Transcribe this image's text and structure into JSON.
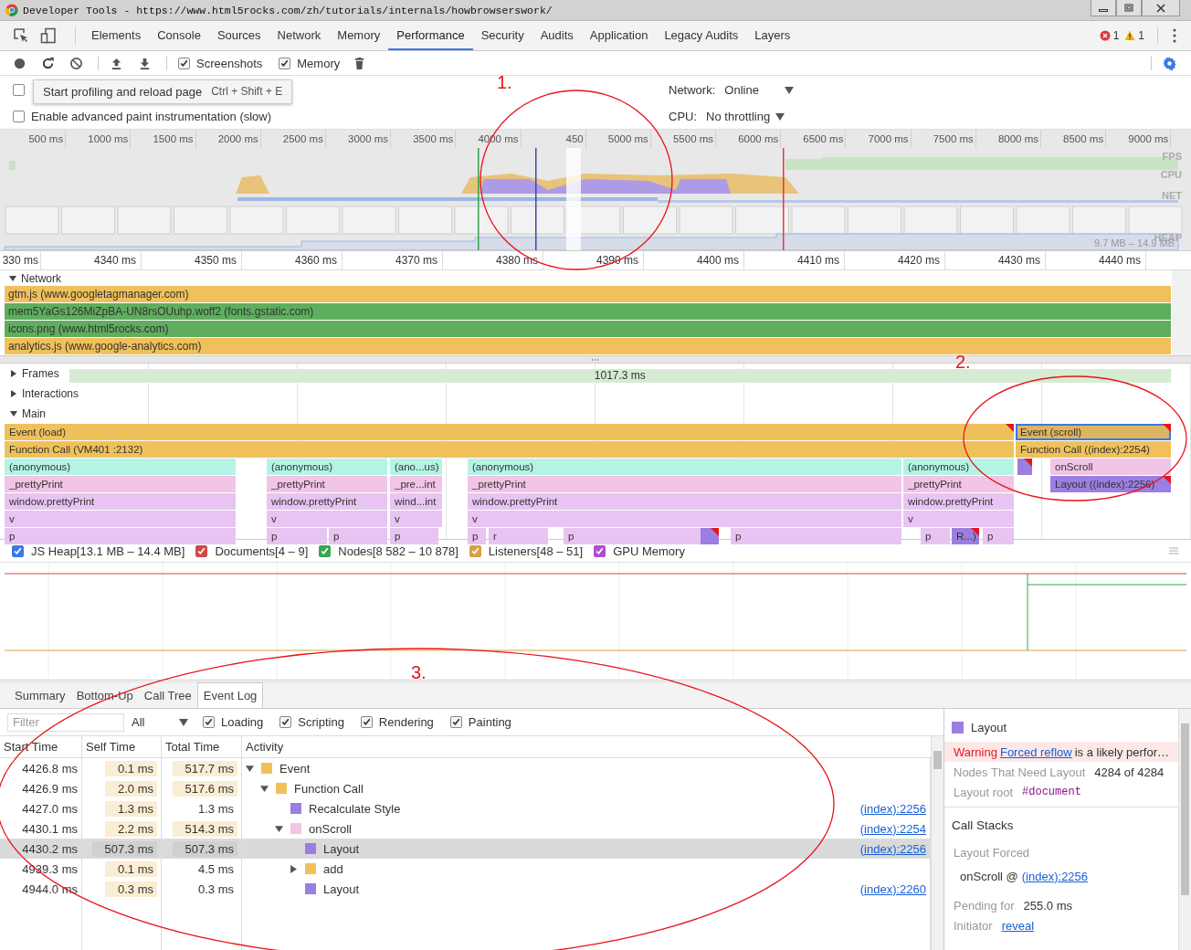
{
  "window": {
    "title": "Developer Tools - https://www.html5rocks.com/zh/tutorials/internals/howbrowserswork/"
  },
  "tabs": [
    {
      "label": "Elements",
      "selected": false
    },
    {
      "label": "Console",
      "selected": false
    },
    {
      "label": "Sources",
      "selected": false
    },
    {
      "label": "Network",
      "selected": false
    },
    {
      "label": "Memory",
      "selected": false
    },
    {
      "label": "Performance",
      "selected": true
    },
    {
      "label": "Security",
      "selected": false
    },
    {
      "label": "Audits",
      "selected": false
    },
    {
      "label": "Application",
      "selected": false
    },
    {
      "label": "Legacy Audits",
      "selected": false
    },
    {
      "label": "Layers",
      "selected": false
    }
  ],
  "issues": {
    "errors": "1",
    "warnings": "1"
  },
  "toolbar": {
    "checkboxes": [
      {
        "label": "Screenshots",
        "checked": true
      },
      {
        "label": "Memory",
        "checked": true
      }
    ]
  },
  "settings": {
    "options": [
      {
        "checked": false
      },
      {
        "label": "Enable advanced paint instrumentation (slow)",
        "checked": false
      }
    ],
    "tooltip": {
      "text": "Start profiling and reload page",
      "shortcut": "Ctrl + Shift + E"
    },
    "network": {
      "label": "Network:",
      "value": "Online"
    },
    "cpu": {
      "label": "CPU:",
      "value": "No throttling"
    }
  },
  "overview": {
    "ticks": [
      "500 ms",
      "1000 ms",
      "1500 ms",
      "2000 ms",
      "2500 ms",
      "3000 ms",
      "3500 ms",
      "4000 ms",
      "450",
      "5000 ms",
      "5500 ms",
      "6000 ms",
      "6500 ms",
      "7000 ms",
      "7500 ms",
      "8000 ms",
      "8500 ms",
      "9000 ms"
    ],
    "lanes": [
      "FPS",
      "CPU",
      "NET",
      "HEAP"
    ],
    "heap_range": "9.7 MB – 14.9 MB"
  },
  "ruler": [
    "330 ms",
    "4340 ms",
    "4350 ms",
    "4360 ms",
    "4370 ms",
    "4380 ms",
    "4390 ms",
    "4400 ms",
    "4410 ms",
    "4420 ms",
    "4430 ms",
    "4440 ms"
  ],
  "network": {
    "label": "Network",
    "expanded": true,
    "requests": [
      {
        "name": "gtm.js (www.googletagmanager.com)",
        "color": "#f0c15b"
      },
      {
        "name": "mem5YaGs126MiZpBA-UN8rsOUuhp.woff2 (fonts.gstatic.com)",
        "color": "#5fae5f"
      },
      {
        "name": "icons.png (www.html5rocks.com)",
        "color": "#5fae5f"
      },
      {
        "name": "analytics.js (www.google-analytics.com)",
        "color": "#f0c15b"
      }
    ]
  },
  "tracks": [
    {
      "label": "Frames",
      "expanded": false,
      "value": "1017.3 ms"
    },
    {
      "label": "Interactions",
      "expanded": false
    },
    {
      "label": "Main",
      "expanded": true
    }
  ],
  "flame": [
    [
      {
        "label": "Event (load)",
        "color": "#f0c15b",
        "warning": true,
        "selected": false
      },
      {
        "label": "Event (scroll)",
        "color": "#ddb55e",
        "warning": true,
        "selected": true
      }
    ],
    [
      {
        "label": "Function Call (VM401 :2132)",
        "color": "#f0c15b",
        "warning": false,
        "selected": false
      },
      {
        "label": "Function Call ((index):2254)",
        "color": "#f0c15b",
        "warning": false,
        "selected": false
      }
    ],
    [
      {
        "label": "(anonymous)",
        "color": "#b4f4e4",
        "warning": false,
        "selected": false
      },
      {
        "label": "(anonymous)",
        "color": "#b4f4e4",
        "warning": false,
        "selected": false
      },
      {
        "label": "(ano...us)",
        "color": "#b4f4e4",
        "warning": false,
        "selected": false
      },
      {
        "label": "(anonymous)",
        "color": "#b4f4e4",
        "warning": false,
        "selected": false
      },
      {
        "label": "(anonymous)",
        "color": "#b4f4e4",
        "warning": false,
        "selected": false
      },
      {
        "color": "#9b7fe0",
        "warning": true,
        "selected": false
      },
      {
        "label": "onScroll",
        "color": "#f2c4e6",
        "warning": false,
        "selected": false
      }
    ],
    [
      {
        "label": "_prettyPrint",
        "color": "#f2c4e6",
        "warning": false,
        "selected": false
      },
      {
        "label": "_prettyPrint",
        "color": "#f2c4e6",
        "warning": false,
        "selected": false
      },
      {
        "label": "_pre...int",
        "color": "#f2c4e6",
        "warning": false,
        "selected": false
      },
      {
        "label": "_prettyPrint",
        "color": "#f2c4e6",
        "warning": false,
        "selected": false
      },
      {
        "label": "_prettyPrint",
        "color": "#f2c4e6",
        "warning": false,
        "selected": false
      },
      {
        "label": "Layout ((index):2256)",
        "color": "#9b7fe0",
        "warning": true,
        "selected": false
      }
    ],
    [
      {
        "label": "window.prettyPrint",
        "color": "#e8c4f2",
        "warning": false,
        "selected": false
      },
      {
        "label": "window.prettyPrint",
        "color": "#e8c4f2",
        "warning": false,
        "selected": false
      },
      {
        "label": "wind...int",
        "color": "#e8c4f2",
        "warning": false,
        "selected": false
      },
      {
        "label": "window.prettyPrint",
        "color": "#e8c4f2",
        "warning": false,
        "selected": false
      },
      {
        "label": "window.prettyPrint",
        "color": "#e8c4f2",
        "warning": false,
        "selected": false
      }
    ],
    [
      {
        "label": "v",
        "color": "#e8c4f2",
        "warning": false,
        "selected": false
      },
      {
        "label": "v",
        "color": "#e8c4f2",
        "warning": false,
        "selected": false
      },
      {
        "label": "v",
        "color": "#e8c4f2",
        "warning": false,
        "selected": false
      },
      {
        "label": "v",
        "color": "#e8c4f2",
        "warning": false,
        "selected": false
      },
      {
        "label": "v",
        "color": "#e8c4f2",
        "warning": false,
        "selected": false
      }
    ],
    [
      {
        "label": "p",
        "color": "#e8c4f2",
        "warning": false,
        "selected": false
      },
      {
        "label": "p",
        "color": "#e8c4f2",
        "warning": false,
        "selected": false
      },
      {
        "label": "p",
        "color": "#e8c4f2",
        "warning": false,
        "selected": false
      },
      {
        "label": "p",
        "color": "#e8c4f2",
        "warning": false,
        "selected": false
      },
      {
        "label": "p",
        "color": "#e8c4f2",
        "warning": false,
        "selected": false
      },
      {
        "label": "r",
        "color": "#e8c4f2",
        "warning": false,
        "selected": false
      },
      {
        "label": "p",
        "color": "#e8c4f2",
        "warning": false,
        "selected": false
      },
      {
        "color": "#9b7fe0",
        "warning": true,
        "selected": false
      },
      {
        "label": "p",
        "color": "#e8c4f2",
        "warning": false,
        "selected": false
      },
      {
        "label": "p",
        "color": "#e8c4f2",
        "warning": false,
        "selected": false
      },
      {
        "label": "R...)",
        "color": "#9b7fe0",
        "warning": true,
        "selected": false
      },
      {
        "label": "p",
        "color": "#e8c4f2",
        "warning": false,
        "selected": false
      }
    ]
  ],
  "counters": [
    {
      "label": "JS Heap[13.1 MB – 14.4 MB]",
      "checked": true,
      "color": "#3b78e7"
    },
    {
      "label": "Documents[4 – 9]",
      "checked": true,
      "color": "#d04848"
    },
    {
      "label": "Nodes[8 582 – 10 878]",
      "checked": true,
      "color": "#34a853"
    },
    {
      "label": "Listeners[48 – 51]",
      "checked": true,
      "color": "#d8a040"
    },
    {
      "label": "GPU Memory",
      "checked": true,
      "color": "#b04fd1"
    }
  ],
  "detail_tabs": [
    {
      "label": "Summary",
      "selected": false
    },
    {
      "label": "Bottom-Up",
      "selected": false
    },
    {
      "label": "Call Tree",
      "selected": false
    },
    {
      "label": "Event Log",
      "selected": true
    }
  ],
  "filter": {
    "placeholder": "Filter",
    "scope": "All",
    "categories": [
      {
        "label": "Loading",
        "checked": true
      },
      {
        "label": "Scripting",
        "checked": true
      },
      {
        "label": "Rendering",
        "checked": true
      },
      {
        "label": "Painting",
        "checked": true
      }
    ]
  },
  "table": {
    "columns": [
      "Start Time",
      "Self Time",
      "Total Time",
      "Activity"
    ],
    "rows": [
      {
        "start": "4426.8 ms",
        "self": "0.1 ms",
        "total": "517.7 ms",
        "total_shaded": true,
        "activity": "Event",
        "color": "#f0c15b",
        "selected": false,
        "expanded": true,
        "children": [
          {
            "start": "4426.9 ms",
            "self": "2.0 ms",
            "total": "517.6 ms",
            "total_shaded": true,
            "activity": "Function Call",
            "color": "#f0c15b",
            "selected": false,
            "expanded": true,
            "children": [
              {
                "start": "4427.0 ms",
                "self": "1.3 ms",
                "total": "1.3 ms",
                "total_shaded": false,
                "activity": "Recalculate Style",
                "color": "#9b7fe0",
                "selected": false,
                "link": "(index):2256"
              },
              {
                "start": "4430.1 ms",
                "self": "2.2 ms",
                "total": "514.3 ms",
                "total_shaded": true,
                "activity": "onScroll",
                "color": "#f2c4e6",
                "selected": false,
                "expanded": true,
                "link": "(index):2254",
                "children": [
                  {
                    "start": "4430.2 ms",
                    "self": "507.3 ms",
                    "total": "507.3 ms",
                    "total_shaded": true,
                    "activity": "Layout",
                    "color": "#9b7fe0",
                    "selected": true,
                    "link": "(index):2256"
                  },
                  {
                    "start": "4939.3 ms",
                    "self": "0.1 ms",
                    "total": "4.5 ms",
                    "total_shaded": false,
                    "activity": "add",
                    "color": "#f0c15b",
                    "selected": false,
                    "expanded": false
                  },
                  {
                    "start": "4944.0 ms",
                    "self": "0.3 ms",
                    "total": "0.3 ms",
                    "total_shaded": false,
                    "activity": "Layout",
                    "color": "#9b7fe0",
                    "selected": false,
                    "link": "(index):2260"
                  }
                ]
              }
            ]
          }
        ]
      }
    ]
  },
  "details": {
    "title": "Layout",
    "color": "#9b7fe0",
    "warning": {
      "label": "Warning",
      "link": "Forced reflow",
      "text": "is a likely perfor…"
    },
    "fields": [
      {
        "label": "Nodes That Need Layout",
        "value": "4284 of 4284",
        "kind": "plain"
      },
      {
        "label": "Layout root",
        "value": "#document",
        "kind": "code"
      }
    ],
    "call_stacks": {
      "title": "Call Stacks",
      "label": "Layout Forced",
      "frame": "onScroll @",
      "link": "(index):2256"
    },
    "extra": [
      {
        "label": "Pending for",
        "value": "255.0 ms",
        "kind": "plain"
      },
      {
        "label": "Initiator",
        "value": "reveal",
        "kind": "link"
      }
    ]
  },
  "annotations": [
    {
      "label": "1."
    },
    {
      "label": "2."
    },
    {
      "label": "3."
    }
  ]
}
